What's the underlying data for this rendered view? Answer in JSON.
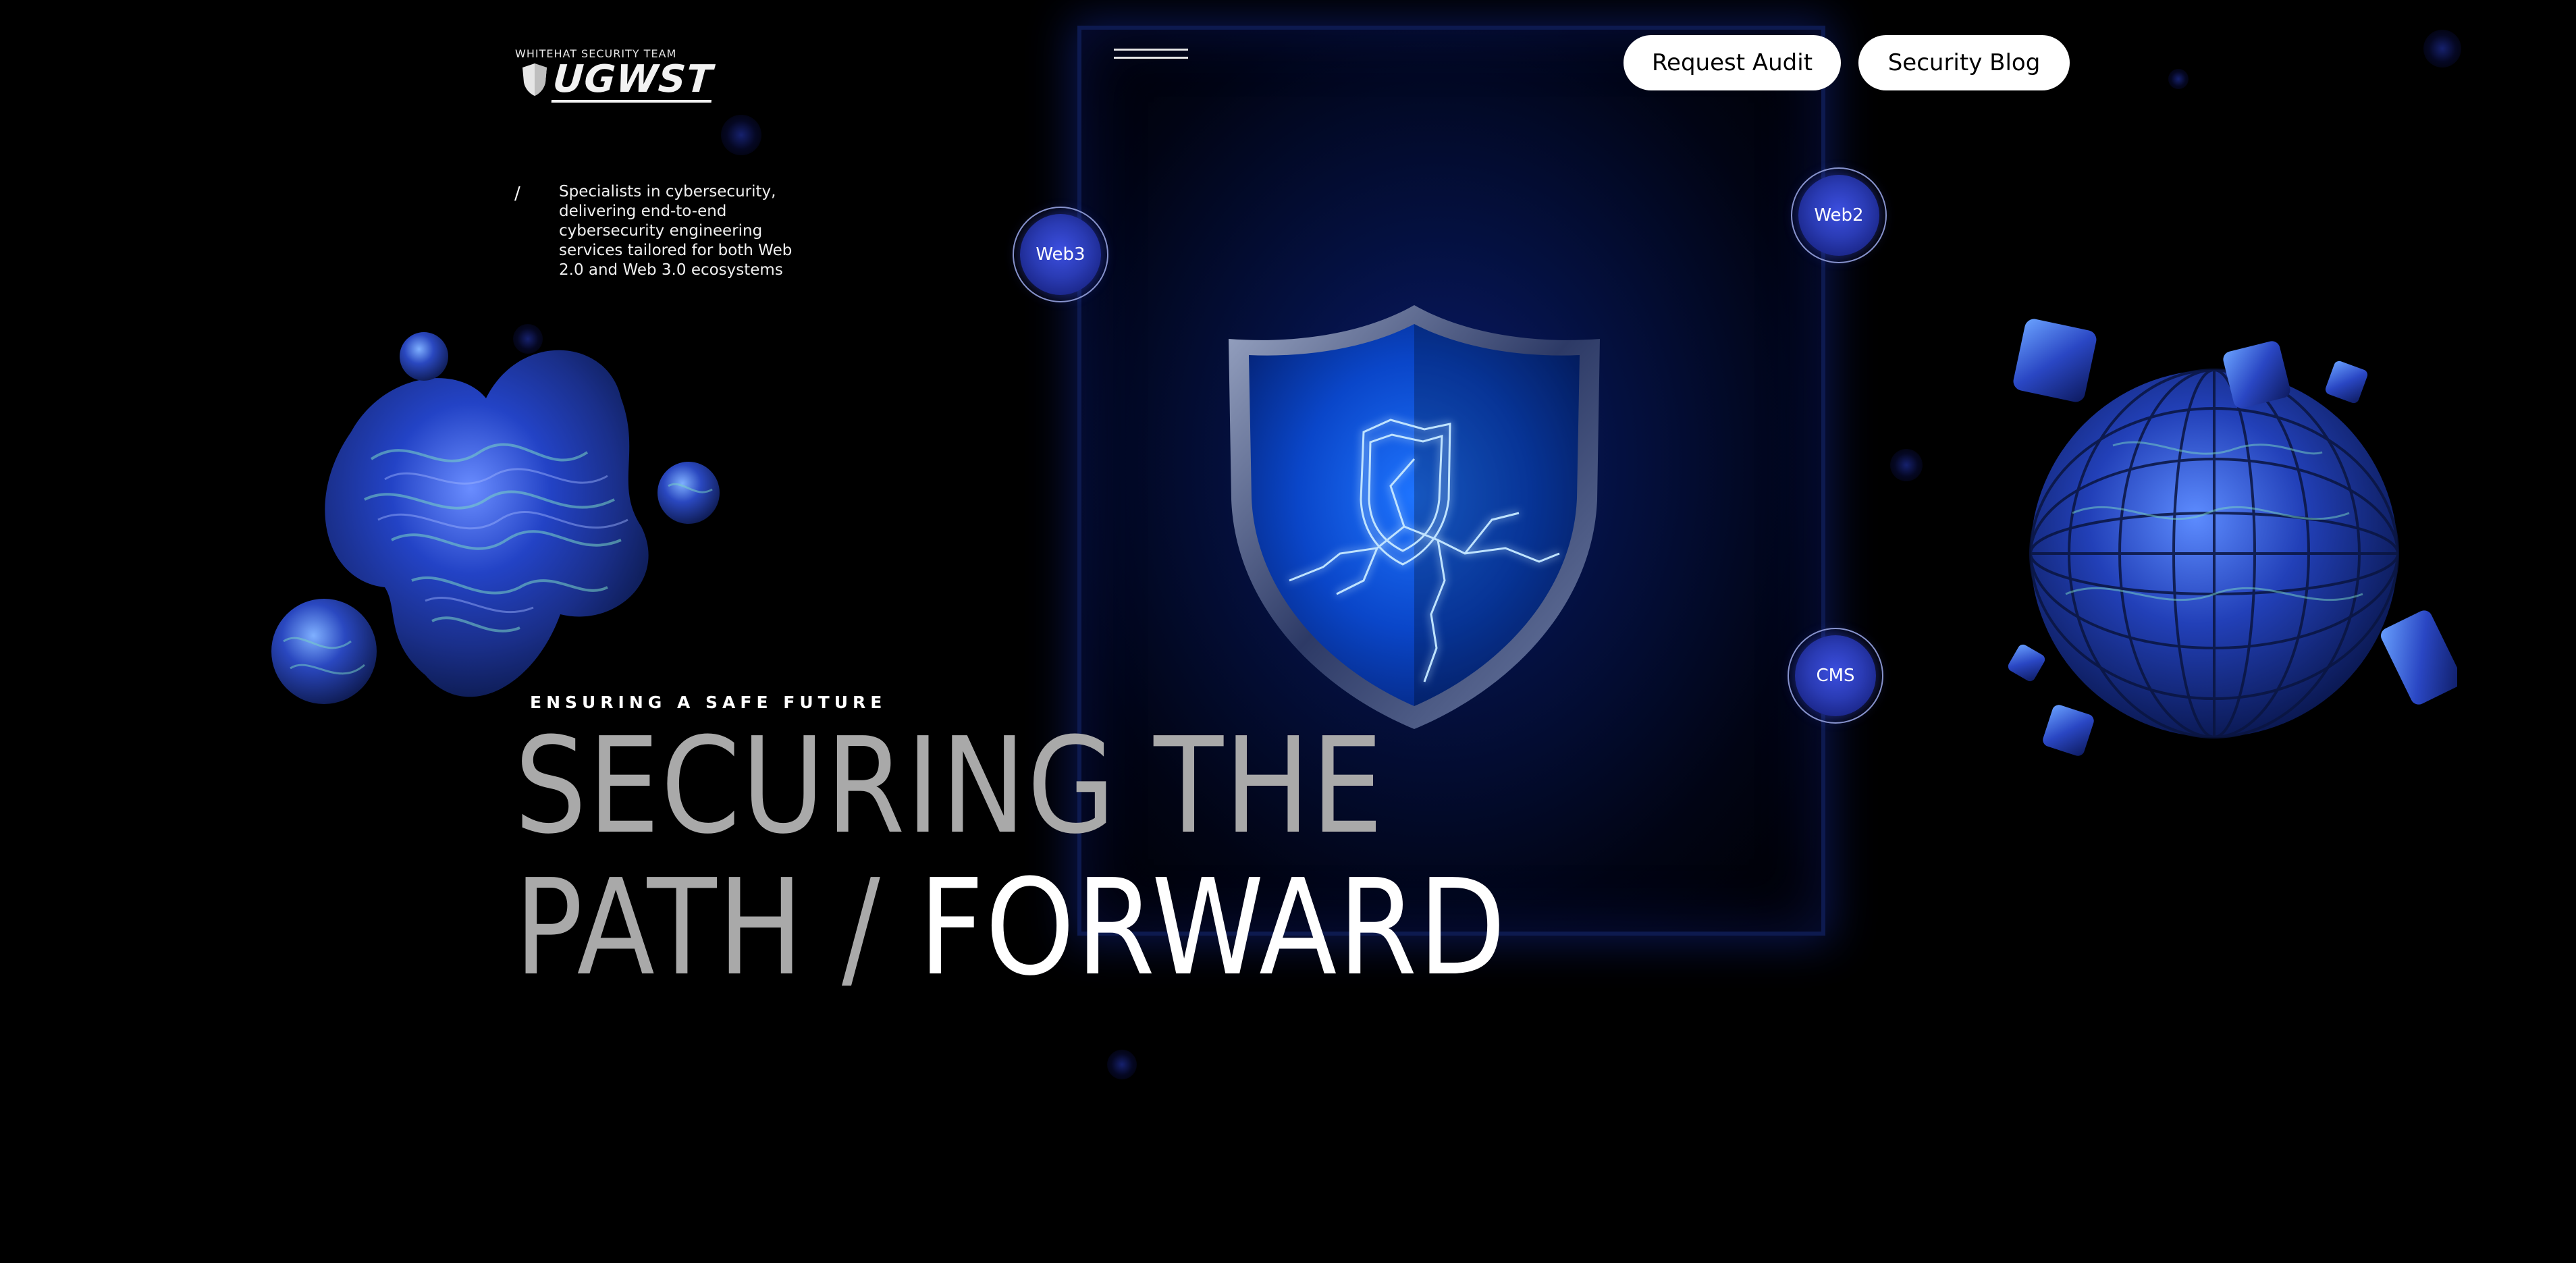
{
  "brand": {
    "tagline": "WHITEHAT SECURITY TEAM",
    "name": "UGWST"
  },
  "nav": {
    "request_audit": "Request Audit",
    "security_blog": "Security Blog",
    "menu_icon": "hamburger-menu-icon"
  },
  "intro": {
    "slash": "/",
    "description": "Specialists in cybersecurity, delivering end-to-end cybersecurity engineering services tailored for both Web 2.0 and Web 3.0 ecosystems"
  },
  "tags": {
    "web3": "Web3",
    "web2": "Web2",
    "cms": "CMS"
  },
  "hero": {
    "eyebrow": "ENSURING A SAFE FUTURE",
    "line1": "SECURING THE",
    "line2_grey": "PATH / ",
    "line2_white": "FORWARD"
  },
  "colors": {
    "background": "#000000",
    "accent_blue": "#2a3bb4",
    "headline_grey": "#a9a9a9",
    "button_bg": "#ffffff"
  },
  "icons": {
    "center": "shield-lightning-icon",
    "left_art": "fluid-blob-art",
    "right_art": "cube-sphere-art"
  }
}
